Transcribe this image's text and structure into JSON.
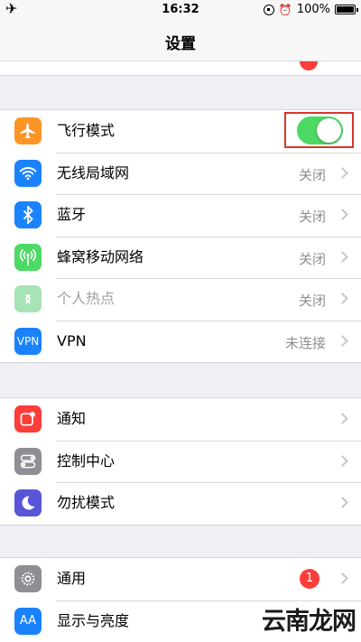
{
  "status_bar": {
    "time": "16:32",
    "battery": "100%"
  },
  "nav": {
    "title": "设置"
  },
  "colors": {
    "orange": "#fd9426",
    "blue": "#1a82fb",
    "green": "#4cd964",
    "light_green": "#a6e3b5",
    "red": "#fc3d39",
    "gray": "#8e8e93",
    "purple": "#5856d6",
    "toggle_on": "#4cd964",
    "highlight": "#d9362b"
  },
  "group1": {
    "airplane": {
      "label": "飞行模式",
      "icon": "airplane-icon",
      "toggle_on": true
    },
    "wifi": {
      "label": "无线局域网",
      "value": "关闭",
      "icon": "wifi-icon"
    },
    "bluetooth": {
      "label": "蓝牙",
      "value": "关闭",
      "icon": "bluetooth-icon"
    },
    "cellular": {
      "label": "蜂窝移动网络",
      "value": "关闭",
      "icon": "cellular-icon"
    },
    "hotspot": {
      "label": "个人热点",
      "value": "关闭",
      "icon": "hotspot-icon"
    },
    "vpn": {
      "label": "VPN",
      "value": "未连接",
      "icon_text": "VPN"
    }
  },
  "group2": {
    "notifications": {
      "label": "通知",
      "icon": "notifications-icon"
    },
    "control_center": {
      "label": "控制中心",
      "icon": "control-center-icon"
    },
    "dnd": {
      "label": "勿扰模式",
      "icon": "moon-icon"
    }
  },
  "group3": {
    "general": {
      "label": "通用",
      "badge": "1",
      "icon": "gear-icon"
    },
    "display": {
      "label": "显示与亮度",
      "icon_text": "AA"
    }
  },
  "watermark": "云南龙网"
}
